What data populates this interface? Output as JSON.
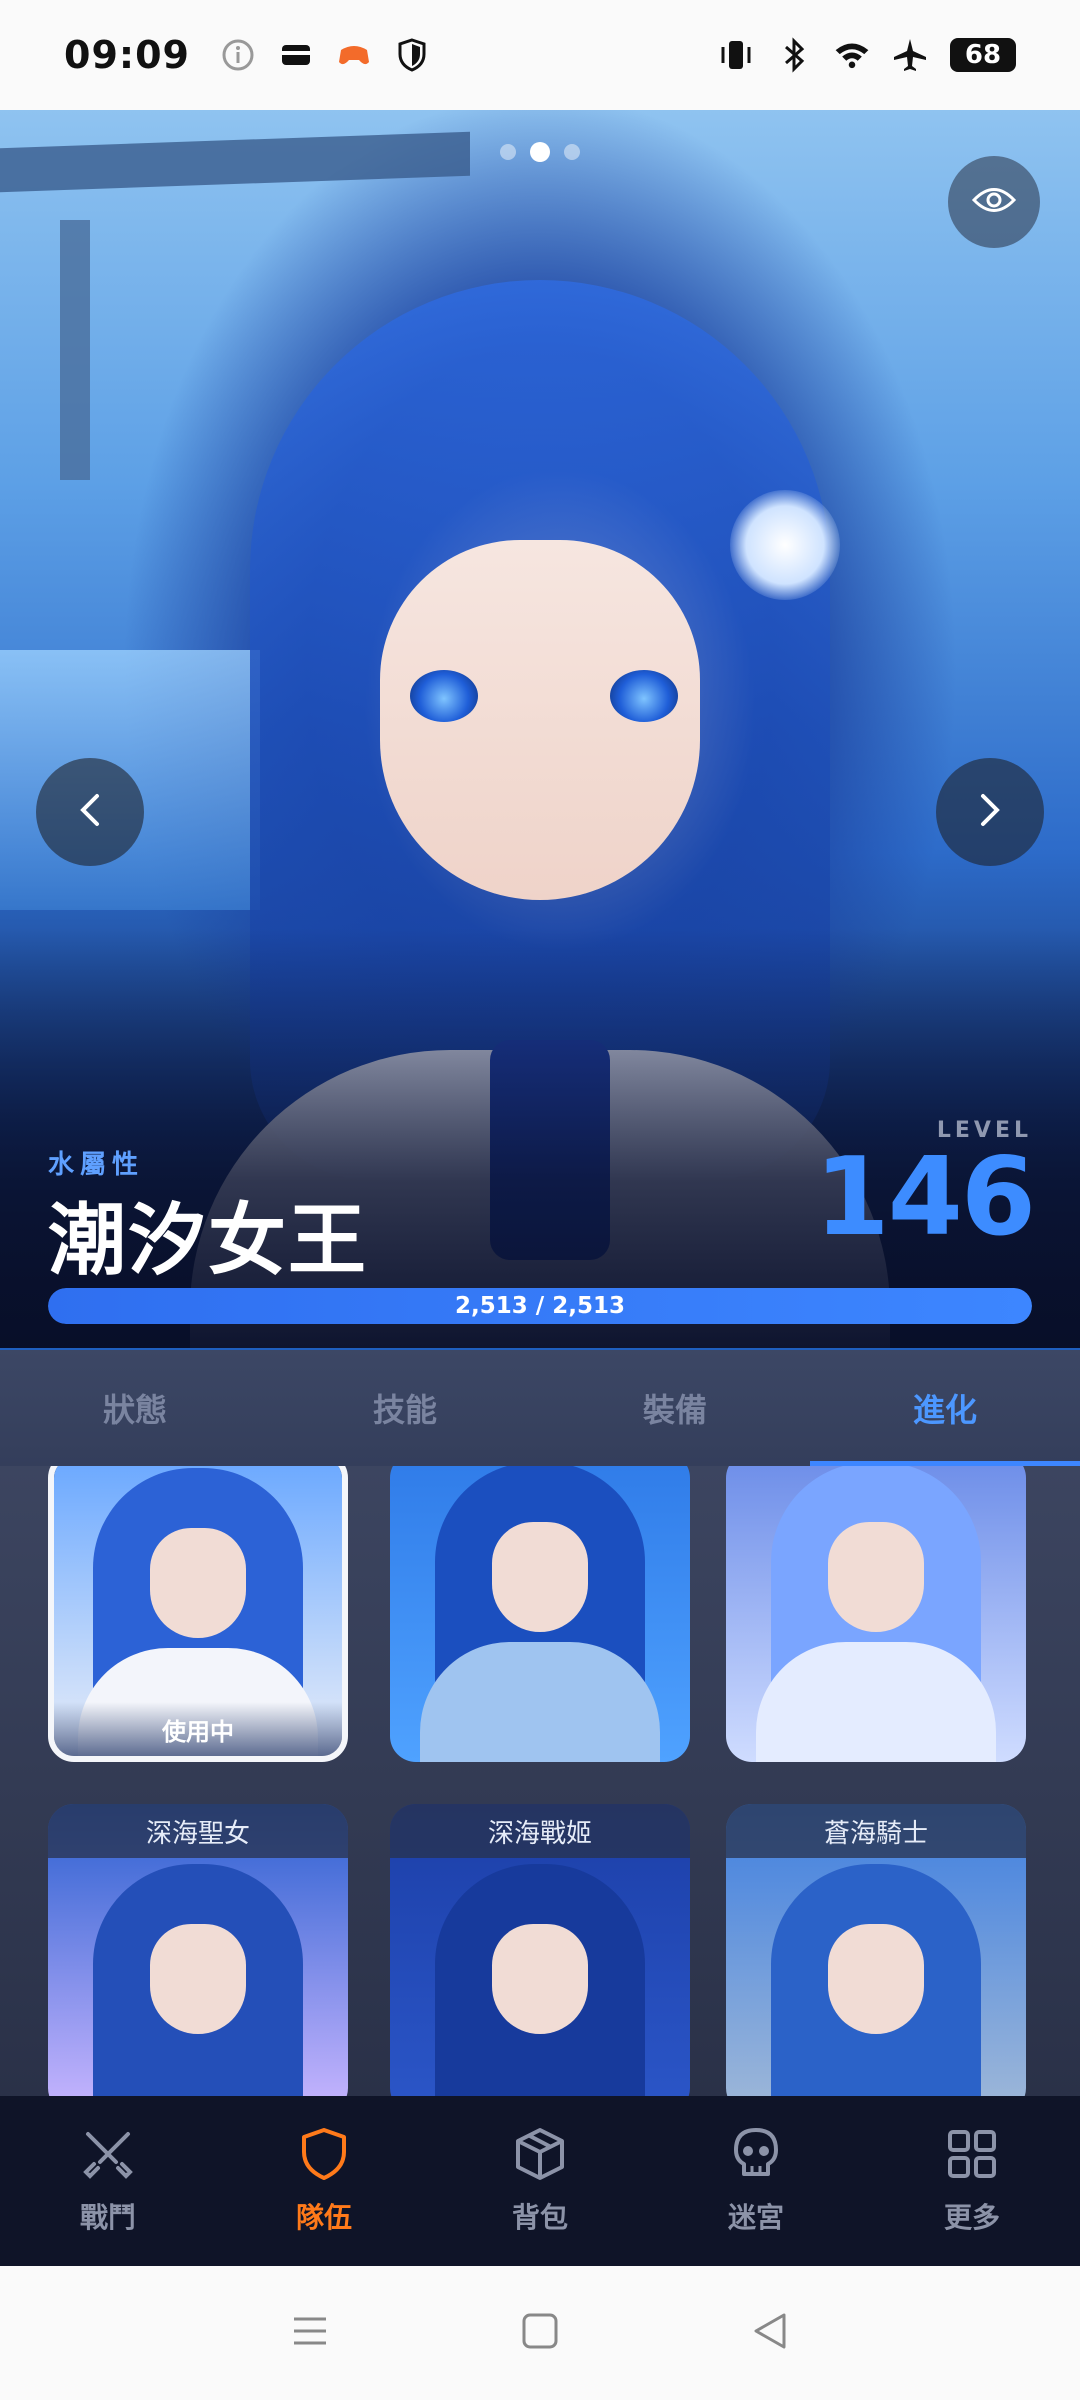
{
  "status_bar": {
    "time": "09:09",
    "left_icons": [
      "info-icon",
      "wallet-icon",
      "game-icon",
      "shield-icon"
    ],
    "right_icons": [
      "vibrate-icon",
      "bluetooth-icon",
      "wifi-icon",
      "airplane-icon"
    ],
    "battery": "68"
  },
  "hero": {
    "carousel_total": 3,
    "carousel_active": 1,
    "element": "水屬性",
    "name": "潮汐女王",
    "level_label": "LEVEL",
    "level": "146",
    "hp_current": 2513,
    "hp_max": 2513,
    "hp_text": "2,513 / 2,513",
    "icons": {
      "toggle": "eye-icon",
      "prev": "chevron-left-icon",
      "next": "chevron-right-icon"
    }
  },
  "tabs": [
    {
      "label": "狀態",
      "active": false
    },
    {
      "label": "技能",
      "active": false
    },
    {
      "label": "裝備",
      "active": false
    },
    {
      "label": "進化",
      "active": true
    }
  ],
  "skins": [
    {
      "title": "",
      "badge": "使用中",
      "selected": true,
      "colors": [
        "#6aa8ff",
        "#e9eef8"
      ]
    },
    {
      "title": "",
      "badge": "",
      "selected": false,
      "colors": [
        "#2f7be8",
        "#4fa2ff"
      ]
    },
    {
      "title": "",
      "badge": "",
      "selected": false,
      "colors": [
        "#6b8ce8",
        "#cfdcff"
      ]
    },
    {
      "title": "深海聖女",
      "badge": "",
      "selected": false,
      "colors": [
        "#2a5fd0",
        "#c9b6ff"
      ]
    },
    {
      "title": "深海戰姬",
      "badge": "",
      "selected": false,
      "colors": [
        "#1c3fa8",
        "#2b56c8"
      ]
    },
    {
      "title": "蒼海騎士",
      "badge": "",
      "selected": false,
      "colors": [
        "#3f7fe0",
        "#9fb8d8"
      ]
    }
  ],
  "bottom_nav": [
    {
      "label": "戰鬥",
      "icon": "swords-icon",
      "active": false
    },
    {
      "label": "隊伍",
      "icon": "shield-icon",
      "active": true
    },
    {
      "label": "背包",
      "icon": "box-icon",
      "active": false
    },
    {
      "label": "迷宮",
      "icon": "skull-icon",
      "active": false
    },
    {
      "label": "更多",
      "icon": "grid-icon",
      "active": false
    }
  ],
  "system_nav": {
    "icons": [
      "menu-icon",
      "home-icon",
      "back-icon"
    ]
  },
  "colors": {
    "accent": "#3d86ff",
    "active_nav": "#ff7a1a",
    "nav_bg": "#0f1428"
  }
}
